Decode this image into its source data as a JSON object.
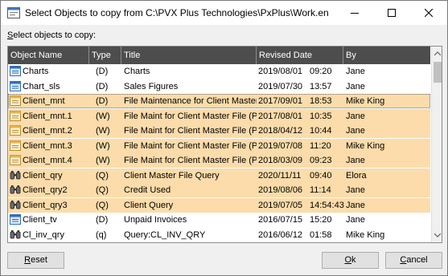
{
  "window": {
    "title": "Select Objects to copy from C:\\PVX Plus Technologies\\PxPlus\\Work.en"
  },
  "prompt": {
    "label_first": "S",
    "label_rest": "elect objects to copy:"
  },
  "columns": [
    "Object Name",
    "Type",
    "Title",
    "Revised Date",
    "By"
  ],
  "rows": [
    {
      "icon": "form-icon",
      "name": "Charts",
      "type": "(D)",
      "title": "Charts",
      "date": "2019/08/01",
      "time": "09:20",
      "by": "Jane",
      "highlight": false
    },
    {
      "icon": "form-icon",
      "name": "Chart_sls",
      "type": "(D)",
      "title": "Sales Figures",
      "date": "2019/07/30",
      "time": "13:57",
      "by": "Jane",
      "highlight": false
    },
    {
      "icon": "window-icon",
      "name": "Client_mnt",
      "type": "(D)",
      "title": "File Maintenance for Client Master",
      "date": "2017/09/01",
      "time": "18:53",
      "by": "Mike King",
      "highlight": true
    },
    {
      "icon": "window-icon",
      "name": "Client_mnt.1",
      "type": "(W)",
      "title": "File Maint for Client Master File (Pa...",
      "date": "2017/08/01",
      "time": "10:35",
      "by": "Jane",
      "highlight": true
    },
    {
      "icon": "window-icon",
      "name": "Client_mnt.2",
      "type": "(W)",
      "title": "File Maint for Client Master File (Pa...",
      "date": "2018/04/12",
      "time": "10:44",
      "by": "Jane",
      "highlight": true
    },
    {
      "icon": "window-icon",
      "name": "Client_mnt.3",
      "type": "(W)",
      "title": "File Maint for Client Master File (Pa...",
      "date": "2019/07/08",
      "time": "11:20",
      "by": "Mike King",
      "highlight": true
    },
    {
      "icon": "window-icon",
      "name": "Client_mnt.4",
      "type": "(W)",
      "title": "File Maint for Client Master File (Pa...",
      "date": "2018/03/09",
      "time": "09:23",
      "by": "Jane",
      "highlight": true
    },
    {
      "icon": "query-icon",
      "name": "Client_qry",
      "type": "(Q)",
      "title": "Client Master File Query",
      "date": "2020/11/11",
      "time": "09:40",
      "by": "Elora",
      "highlight": true
    },
    {
      "icon": "query-icon",
      "name": "Client_qry2",
      "type": "(Q)",
      "title": "Credit Used",
      "date": "2019/08/06",
      "time": "11:14",
      "by": "Jane",
      "highlight": true
    },
    {
      "icon": "query-icon",
      "name": "Client_qry3",
      "type": "(Q)",
      "title": "Client Query",
      "date": "2019/07/05",
      "time": "14:54:43",
      "by": "Jane",
      "highlight": true
    },
    {
      "icon": "form-icon",
      "name": "Client_tv",
      "type": "(D)",
      "title": "Unpaid Invoices",
      "date": "2016/07/15",
      "time": "15:20",
      "by": "Jane",
      "highlight": false
    },
    {
      "icon": "query-icon",
      "name": "Cl_inv_qry",
      "type": "(q)",
      "title": "Query:CL_INV_QRY",
      "date": "2016/06/12",
      "time": "01:58",
      "by": "Mike King",
      "highlight": false
    }
  ],
  "buttons": {
    "reset_first": "R",
    "reset_rest": "eset",
    "ok_first": "O",
    "ok_rest": "k",
    "cancel_first": "C",
    "cancel_rest": "ancel"
  },
  "colors": {
    "header_bg": "#4d4d4d",
    "highlight_bg": "#fcdcaa"
  }
}
